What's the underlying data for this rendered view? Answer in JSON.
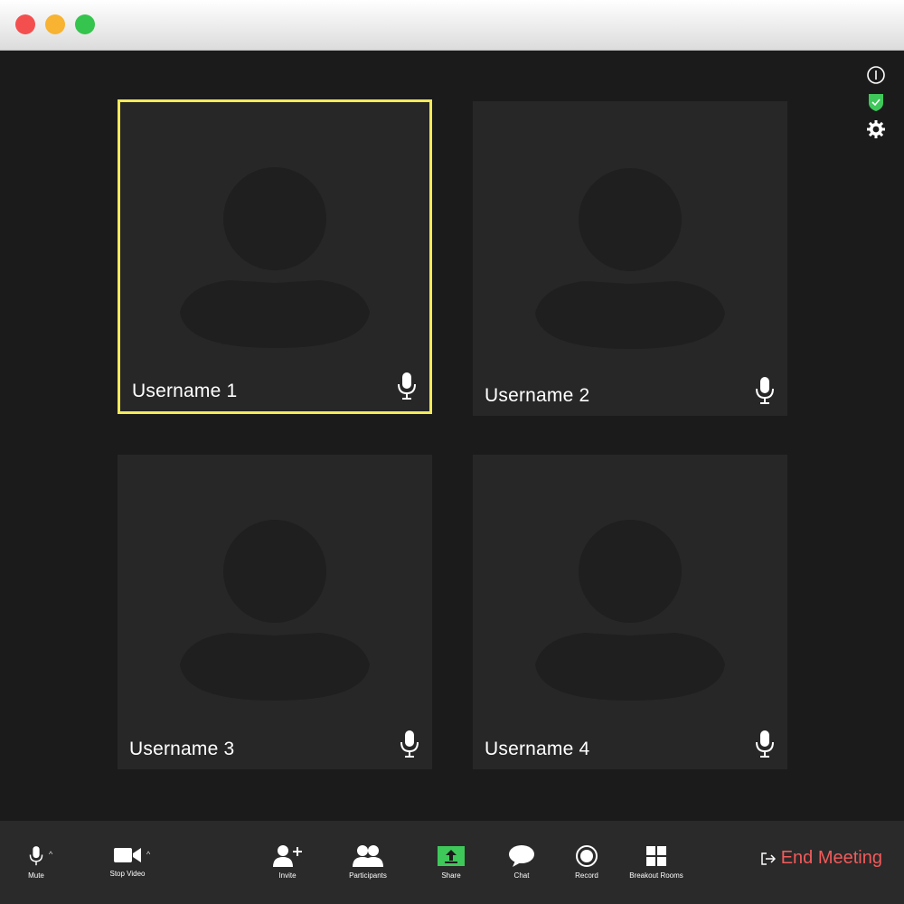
{
  "window": {
    "traffic_lights": [
      "close",
      "minimize",
      "zoom"
    ]
  },
  "side_icons": [
    "info-icon",
    "security-shield-icon",
    "settings-gear-icon"
  ],
  "participants": [
    {
      "name": "Username 1",
      "active": true,
      "mic_icon": "microphone-icon"
    },
    {
      "name": "Username 2",
      "active": false,
      "mic_icon": "microphone-icon"
    },
    {
      "name": "Username 3",
      "active": false,
      "mic_icon": "microphone-icon"
    },
    {
      "name": "Username 4",
      "active": false,
      "mic_icon": "microphone-icon"
    }
  ],
  "toolbar": {
    "mute_label": "Mute",
    "stop_video_label": "Stop Video",
    "invite_label": "Invite",
    "participants_label": "Participants",
    "share_label": "Share",
    "chat_label": "Chat",
    "record_label": "Record",
    "breakout_rooms_label": "Breakout Rooms",
    "end_meeting_label": "End Meeting"
  },
  "colors": {
    "active_speaker_border": "#f3ea5a",
    "share_button": "#3fc85a",
    "end_meeting": "#f25b5b",
    "background": "#1b1b1b",
    "tile": "#272727"
  }
}
